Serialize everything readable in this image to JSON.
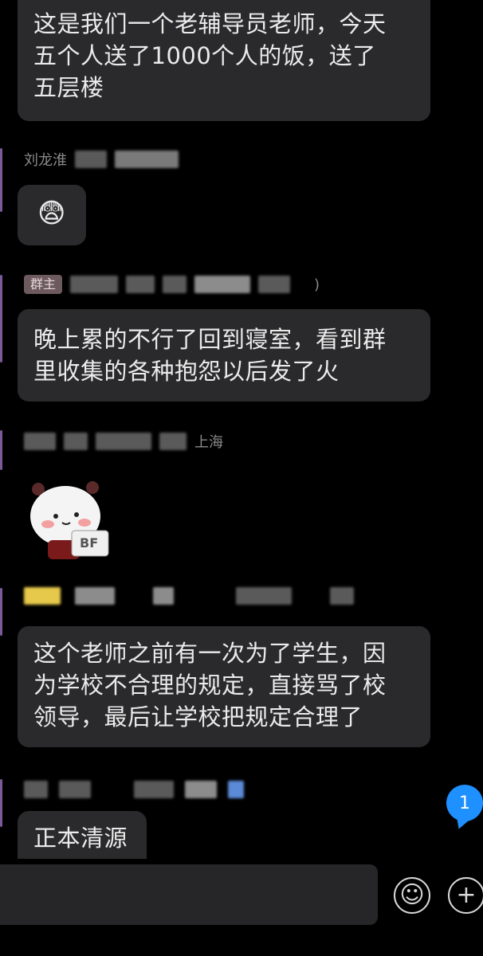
{
  "messages": [
    {
      "text": "这是我们一个老辅导员老师，今天\n五个人送了1000个人的饭，送了\n五层楼"
    },
    {
      "sender": "刘龙淮",
      "emoji": "😨"
    },
    {
      "sender_tag": "群主",
      "sender_tail": ")",
      "text": "晚上累的不行了回到寝室，看到群\n里收集的各种抱怨以后发了火"
    },
    {
      "sender_tail": "上海",
      "sticker_label": "BF"
    },
    {
      "text": "这个老师之前有一次为了学生，因\n为学校不合理的规定，直接骂了校\n领导，最后让学校把规定合理了"
    },
    {
      "text": "正本清源"
    }
  ],
  "unread_count": "1",
  "input": {
    "placeholder": ""
  },
  "controls": {
    "emoji_glyph": "☺",
    "plus_glyph": "+"
  }
}
